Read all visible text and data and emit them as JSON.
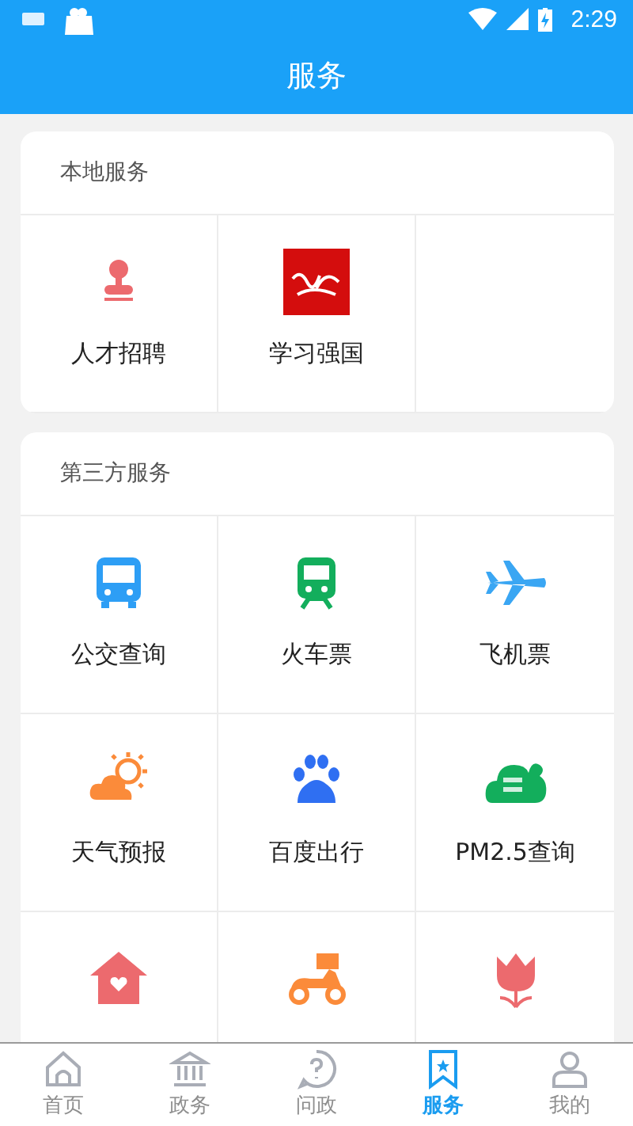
{
  "status_bar": {
    "time": "2:29"
  },
  "header": {
    "title": "服务"
  },
  "sections": [
    {
      "title": "本地服务",
      "items": [
        {
          "label": "人才招聘"
        },
        {
          "label": "学习强国"
        }
      ]
    },
    {
      "title": "第三方服务",
      "items": [
        {
          "label": "公交查询"
        },
        {
          "label": "火车票"
        },
        {
          "label": "飞机票"
        },
        {
          "label": "天气预报"
        },
        {
          "label": "百度出行"
        },
        {
          "label": "PM2.5查询"
        }
      ]
    }
  ],
  "tabs": [
    {
      "label": "首页",
      "selected": false
    },
    {
      "label": "政务",
      "selected": false
    },
    {
      "label": "问政",
      "selected": false
    },
    {
      "label": "服务",
      "selected": true
    },
    {
      "label": "我的",
      "selected": false
    }
  ]
}
